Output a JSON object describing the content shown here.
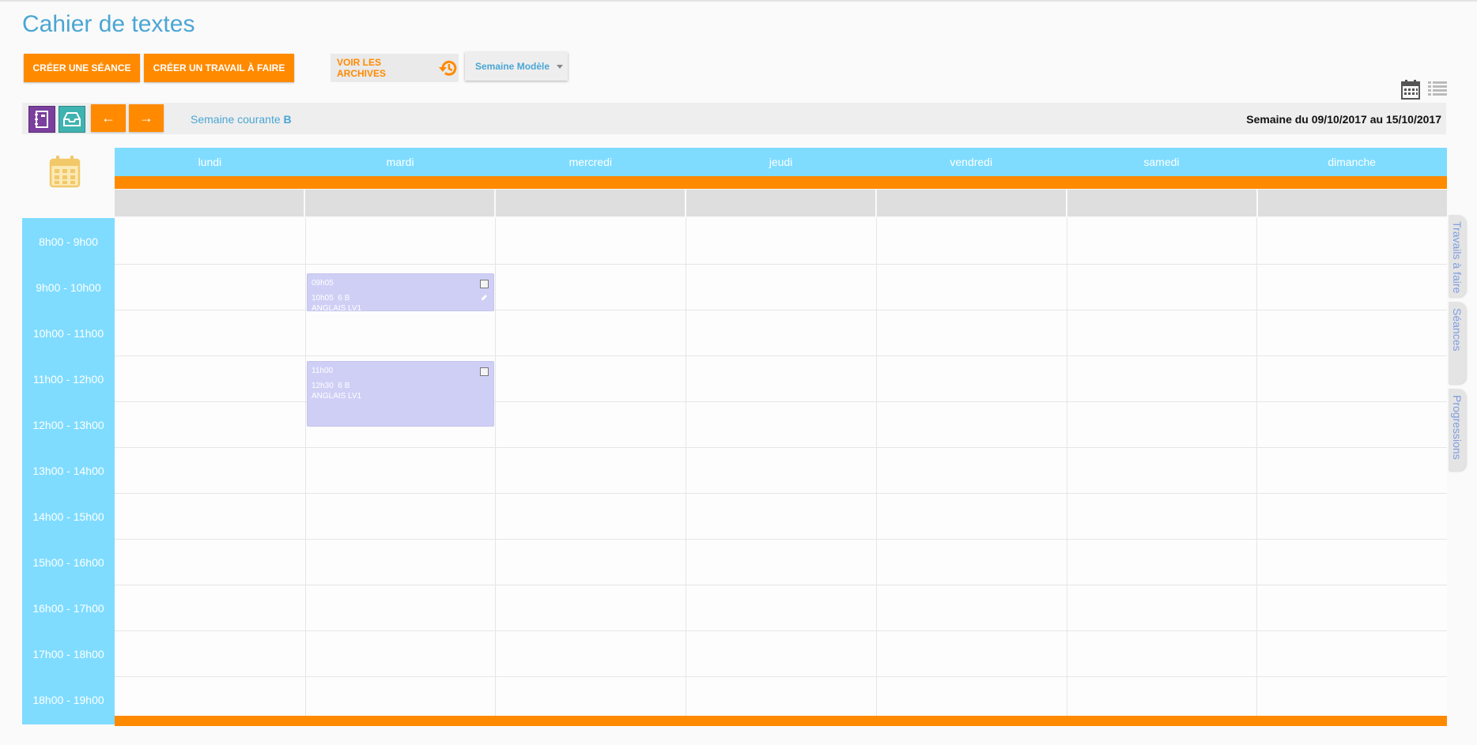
{
  "header": {
    "title": "Cahier de textes",
    "create_session_label": "CRÉER UNE SÉANCE",
    "create_homework_label": "CRÉER UN TRAVAIL À FAIRE",
    "archives_label": "VOIR LES ARCHIVES",
    "week_model_select": "Semaine Modèle"
  },
  "nav": {
    "prev_label": "←",
    "next_label": "→",
    "current_week_prefix": "Semaine courante",
    "current_week_letter": "B",
    "week_range": "Semaine du 09/10/2017 au 15/10/2017"
  },
  "days": [
    "lundi",
    "mardi",
    "mercredi",
    "jeudi",
    "vendredi",
    "samedi",
    "dimanche"
  ],
  "hours": [
    "8h00 - 9h00",
    "9h00 - 10h00",
    "10h00 - 11h00",
    "11h00 - 12h00",
    "12h00 - 13h00",
    "13h00 - 14h00",
    "14h00 - 15h00",
    "15h00 - 16h00",
    "16h00 - 17h00",
    "17h00 - 18h00",
    "18h00 - 19h00"
  ],
  "events": [
    {
      "start": "09h05",
      "end": "10h05",
      "group": "6 B",
      "subject": "ANGLAIS LV1"
    },
    {
      "start": "11h00",
      "end": "12h30",
      "group": "6 B",
      "subject": "ANGLAIS LV1"
    }
  ],
  "side_tabs": [
    "Travails à faire",
    "Séances",
    "Progressions"
  ],
  "colors": {
    "accent": "#ff8a00",
    "title": "#4aa6d4",
    "header_bg": "#7fdcff",
    "event_bg": "#cfcff6"
  }
}
